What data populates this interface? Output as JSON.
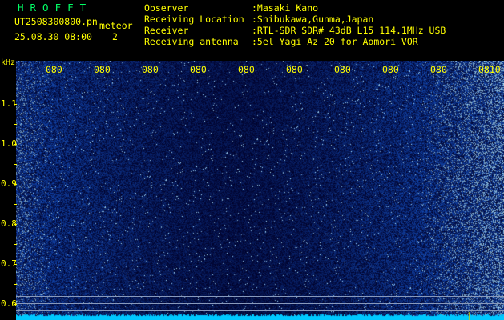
{
  "header": {
    "brand": "HROFFT",
    "file_name": "UT2508300800.pn",
    "mode": "meteor",
    "datetime": "25.08.30 08:00",
    "count": "2_"
  },
  "info": [
    {
      "key": "Observer",
      "value": ":Masaki Kano"
    },
    {
      "key": "Receiving Location",
      "value": ":Shibukawa,Gunma,Japan"
    },
    {
      "key": "Receiver",
      "value": ":RTL-SDR SDR# 43dB L15 114.1MHz USB"
    },
    {
      "key": "Receiving antenna",
      "value": ":5el Yagi Az 20 for Aomori VOR"
    }
  ],
  "axis": {
    "unit": "kHz",
    "ticks": [
      "1.1",
      "1.0",
      "0.9",
      "0.8",
      "0.7",
      "0.6"
    ]
  },
  "time_labels": [
    "080",
    "080",
    "080",
    "080",
    "080",
    "080",
    "080",
    "080",
    "080",
    "080",
    "0810"
  ],
  "colors": {
    "background": "#000000",
    "text": "#ffff00",
    "brand": "#00ff66",
    "noise_base": "#0a0a5a",
    "baseline": "#00c8ff"
  }
}
